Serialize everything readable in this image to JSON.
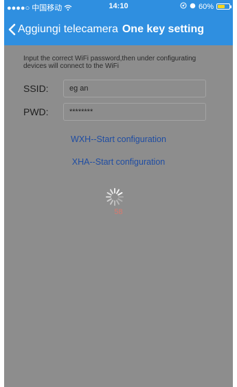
{
  "status_bar": {
    "carrier": "●●●●○ 中国移动",
    "wifi_icon": "wifi-icon",
    "time": "14:10",
    "battery_percent": "60%",
    "battery_level": 0.6,
    "battery_color": "#f7d51e"
  },
  "nav": {
    "back_label": "Aggiungi telecamera",
    "title": "One key setting",
    "bar_color": "#2f8fe0"
  },
  "form": {
    "instruction": "Input the correct WiFi password,then under configurating devices will connect to the WiFi",
    "ssid_label": "SSID:",
    "ssid_value": "eg an",
    "pwd_label": "PWD:",
    "pwd_value": "********"
  },
  "actions": {
    "wxh_label": "WXH--Start configuration",
    "xha_label": "XHA--Start configuration"
  },
  "progress": {
    "countdown": "58"
  }
}
